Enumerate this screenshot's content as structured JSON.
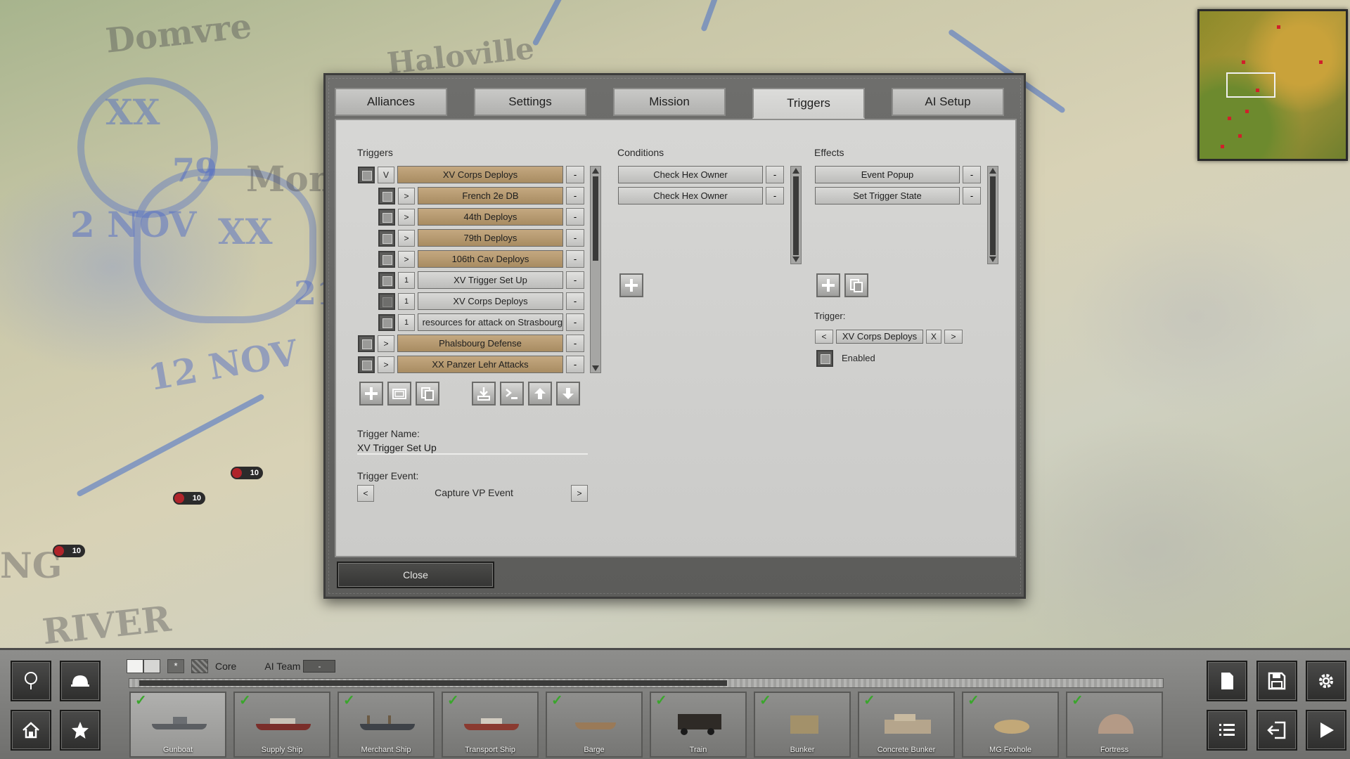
{
  "map": {
    "labels": [
      "Domvre",
      "Haloville",
      "Mon",
      "RIVER",
      "NG"
    ],
    "stamps": [
      "XX",
      "XX",
      "79",
      "2 NOV",
      "12 NOV",
      "21"
    ],
    "unit_strengths": [
      "10",
      "10",
      "10"
    ]
  },
  "dialog": {
    "tabs": [
      {
        "label": "Alliances",
        "active": false
      },
      {
        "label": "Settings",
        "active": false
      },
      {
        "label": "Mission",
        "active": false
      },
      {
        "label": "Triggers",
        "active": true
      },
      {
        "label": "AI Setup",
        "active": false
      }
    ],
    "triggers": {
      "heading": "Triggers",
      "items": [
        {
          "expand": "V",
          "name": "XV  Corps Deploys",
          "style": "tan",
          "remove": "-"
        },
        {
          "expand": ">",
          "name": "French 2e DB",
          "style": "tan",
          "remove": "-"
        },
        {
          "expand": ">",
          "name": "44th Deploys",
          "style": "tan",
          "remove": "-"
        },
        {
          "expand": ">",
          "name": "79th Deploys",
          "style": "tan",
          "remove": "-"
        },
        {
          "expand": ">",
          "name": "106th Cav Deploys",
          "style": "tan",
          "remove": "-"
        },
        {
          "expand": "1",
          "name": "XV Trigger Set Up",
          "style": "grey",
          "remove": "-"
        },
        {
          "expand": "1",
          "name": "XV Corps Deploys",
          "style": "grey",
          "remove": "-"
        },
        {
          "expand": "1",
          "name": "resources for attack on Strasbourg",
          "style": "grey",
          "remove": "-"
        },
        {
          "expand": ">",
          "name": "Phalsbourg Defense",
          "style": "tan",
          "remove": "-"
        },
        {
          "expand": ">",
          "name": "XX Panzer Lehr Attacks",
          "style": "tan",
          "remove": "-"
        }
      ],
      "toolbar_icons": [
        "add-icon",
        "folder-icon",
        "copy-icon",
        "import-icon",
        "script-icon",
        "move-up-icon",
        "move-down-icon"
      ]
    },
    "conditions": {
      "heading": "Conditions",
      "items": [
        {
          "name": "Check Hex Owner",
          "remove": "-"
        },
        {
          "name": "Check Hex Owner",
          "remove": "-"
        }
      ]
    },
    "effects": {
      "heading": "Effects",
      "items": [
        {
          "name": "Event Popup",
          "remove": "-"
        },
        {
          "name": "Set Trigger State",
          "remove": "-"
        }
      ],
      "trigger_label": "Trigger:",
      "trigger_prev": "<",
      "trigger_value": "XV Corps Deploys",
      "trigger_clear": "X",
      "trigger_next": ">",
      "enabled_label": "Enabled"
    },
    "trigger_name_label": "Trigger Name:",
    "trigger_name_value": "XV Trigger Set Up",
    "trigger_event_label": "Trigger Event:",
    "trigger_event_prev": "<",
    "trigger_event_value": "Capture VP Event",
    "trigger_event_next": ">",
    "close_label": "Close"
  },
  "toolbar": {
    "filter": {
      "star": "*",
      "core_label": "Core",
      "ai_team_label": "AI Team",
      "ai_team_value": "-"
    },
    "left_buttons": [
      "tree-icon",
      "helmet-icon",
      "home-icon",
      "star-icon"
    ],
    "right_buttons": [
      "page-icon",
      "save-icon",
      "gear-icon",
      "list-icon",
      "exit-icon",
      "play-icon"
    ],
    "units": [
      {
        "label": "Gunboat",
        "checked": true
      },
      {
        "label": "Supply Ship",
        "checked": true
      },
      {
        "label": "Merchant Ship",
        "checked": true
      },
      {
        "label": "Transport Ship",
        "checked": true
      },
      {
        "label": "Barge",
        "checked": true
      },
      {
        "label": "Train",
        "checked": true
      },
      {
        "label": "Bunker",
        "checked": true
      },
      {
        "label": "Concrete Bunker",
        "checked": true
      },
      {
        "label": "MG Foxhole",
        "checked": true
      },
      {
        "label": "Fortress",
        "checked": true
      }
    ],
    "check_glyph": "✓"
  }
}
